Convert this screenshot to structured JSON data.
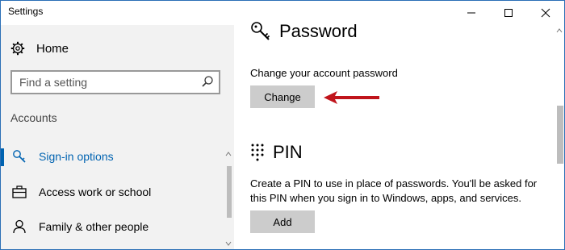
{
  "window": {
    "title": "Settings"
  },
  "sidebar": {
    "home_label": "Home",
    "search_placeholder": "Find a setting",
    "group_label": "Accounts",
    "items": [
      {
        "label": "Sign-in options",
        "icon": "key-icon",
        "active": true
      },
      {
        "label": "Access work or school",
        "icon": "briefcase-icon",
        "active": false
      },
      {
        "label": "Family & other people",
        "icon": "person-icon",
        "active": false
      }
    ]
  },
  "password": {
    "title": "Password",
    "description": "Change your account password",
    "button_label": "Change"
  },
  "pin": {
    "title": "PIN",
    "description_line1": "Create a PIN to use in place of passwords. You'll be asked for",
    "description_line2": "this PIN when you sign in to Windows, apps, and services.",
    "button_label": "Add"
  },
  "colors": {
    "accent": "#0063b1",
    "annotation_arrow": "#c0141b",
    "button_bg": "#cccccc"
  }
}
